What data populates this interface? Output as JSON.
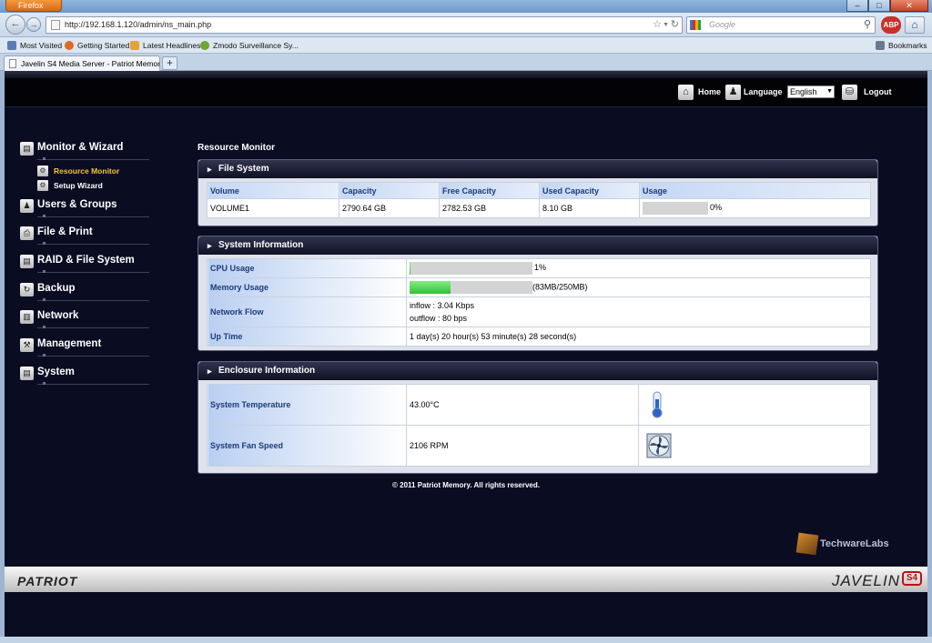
{
  "browser": {
    "app_button": "Firefox",
    "url": "http://192.168.1.120/admin/ns_main.php",
    "search_placeholder": "Google",
    "tab_title": "Javelin S4 Media Server - Patriot Memory",
    "bookmarks": [
      "Most Visited",
      "Getting Started",
      "Latest Headlines",
      "Zmodo Surveillance Sy..."
    ],
    "bookmarks_menu": "Bookmarks"
  },
  "topnav": {
    "home": "Home",
    "language_label": "Language",
    "language_value": "English",
    "logout": "Logout"
  },
  "sidebar": {
    "menu": [
      {
        "label": "Monitor & Wizard",
        "icon": "monitor-icon"
      },
      {
        "label": "Users & Groups",
        "icon": "users-icon"
      },
      {
        "label": "File & Print",
        "icon": "print-icon"
      },
      {
        "label": "RAID & File System",
        "icon": "raid-icon"
      },
      {
        "label": "Backup",
        "icon": "backup-icon"
      },
      {
        "label": "Network",
        "icon": "network-icon"
      },
      {
        "label": "Management",
        "icon": "management-icon"
      },
      {
        "label": "System",
        "icon": "system-icon"
      }
    ],
    "submenu": [
      {
        "label": "Resource Monitor",
        "active": true
      },
      {
        "label": "Setup Wizard",
        "active": false
      }
    ]
  },
  "content": {
    "title": "Resource Monitor",
    "file_system": {
      "heading": "File System",
      "columns": [
        "Volume",
        "Capacity",
        "Free Capacity",
        "Used Capacity",
        "Usage"
      ],
      "rows": [
        {
          "volume": "VOLUME1",
          "capacity": "2790.64 GB",
          "free": "2782.53 GB",
          "used": "8.10 GB",
          "usage_text": "0%",
          "usage_fraction": 0.0
        }
      ]
    },
    "system_info": {
      "heading": "System Information",
      "cpu_label": "CPU Usage",
      "cpu_text": "1%",
      "cpu_fraction": 0.01,
      "memory_label": "Memory Usage",
      "memory_text": "(83MB/250MB)",
      "memory_fraction": 0.332,
      "network_label": "Network Flow",
      "inflow": "inflow : 3.04 Kbps",
      "outflow": "outflow : 80 bps",
      "uptime_label": "Up Time",
      "uptime": "1 day(s) 20 hour(s) 53 minute(s) 28 second(s)"
    },
    "enclosure": {
      "heading": "Enclosure Information",
      "temp_label": "System Temperature",
      "temp": "43.00°C",
      "fan_label": "System Fan Speed",
      "fan": "2106 RPM"
    },
    "footer": "© 2011 Patriot Memory. All rights reserved."
  },
  "branding": {
    "left": "PATRIOT",
    "right": "JAVELIN",
    "badge": "S4",
    "watermark": "TechwareLabs"
  }
}
